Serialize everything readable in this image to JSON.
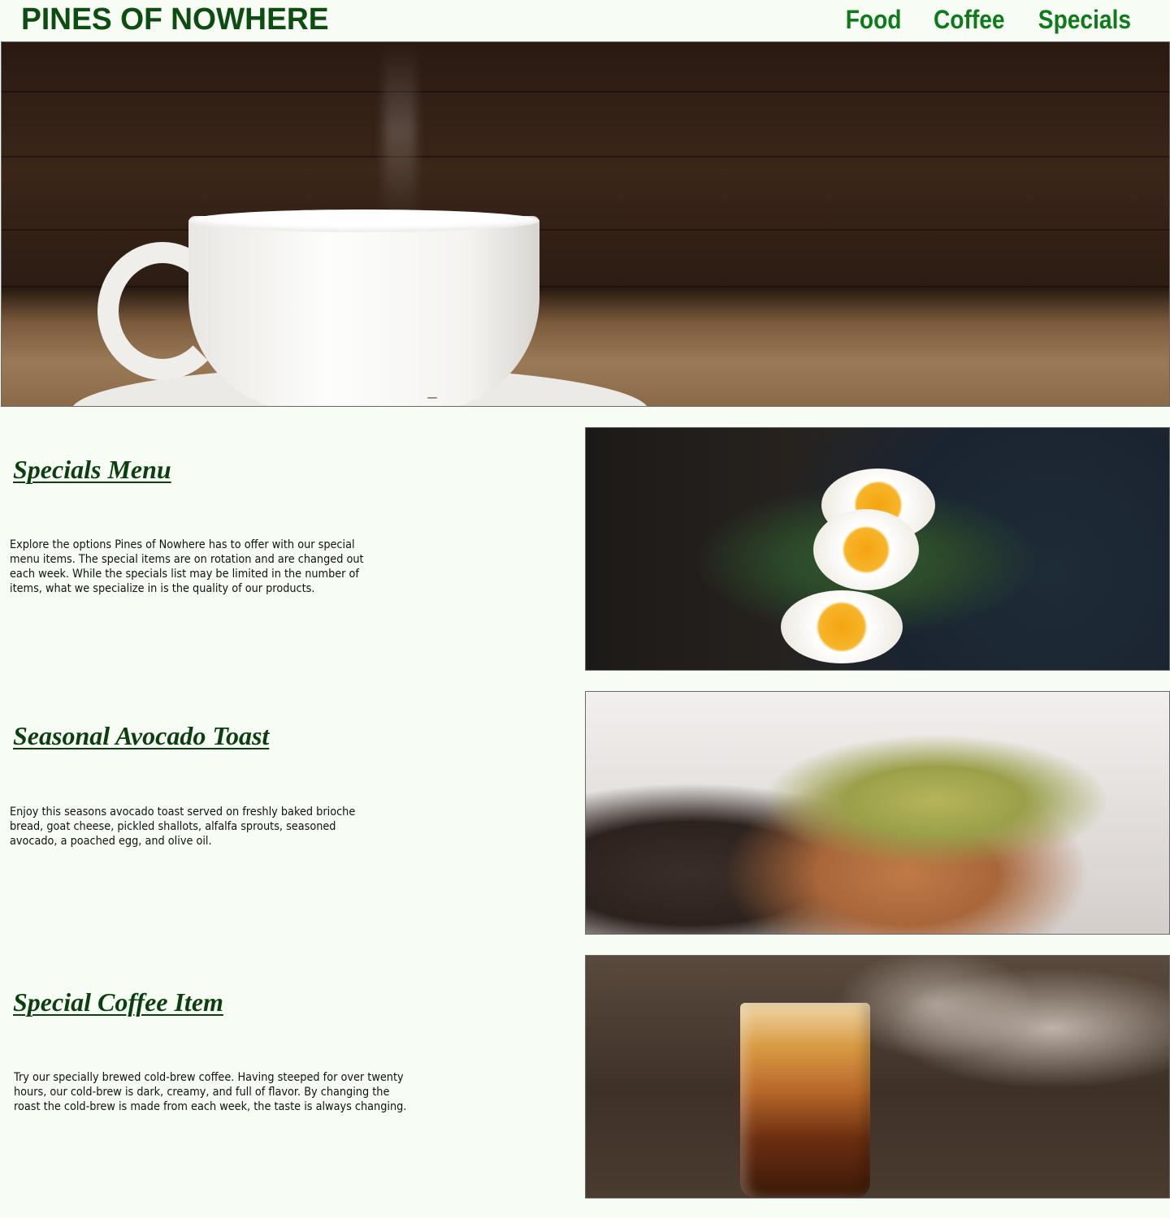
{
  "header": {
    "brand": "PINES OF NOWHERE",
    "nav": [
      "Food",
      "Coffee",
      "Specials"
    ]
  },
  "colors": {
    "background": "#f7fdf4",
    "brand": "#0d4d12",
    "nav": "#0f7a1c",
    "heading": "#0b3f0f"
  },
  "sections": [
    {
      "title": "Specials Menu",
      "body": "Explore the options Pines of Nowhere has to offer with our special menu items. The special items are on rotation and are changed out each week. While the specials list may be limited in the number of items, what we specialize in is the quality of our products.",
      "image": "eggs-avocado-toast-photo"
    },
    {
      "title": "Seasonal Avocado Toast ",
      "body": "Enjoy this seasons avocado toast served on freshly baked brioche bread, goat cheese, pickled shallots, alfalfa sprouts, seasoned avocado, a poached egg, and olive oil.",
      "image": "avocado-toast-poached-egg-photo"
    },
    {
      "title": "Special Coffee Item",
      "body": "Try our specially brewed cold-brew coffee. Having steeped for over twenty hours, our cold-brew is dark, creamy, and full of flavor. By changing the roast the cold-brew is made from each week, the taste is always changing.",
      "image": "iced-cold-brew-photo"
    }
  ],
  "hero_image": "coffee-cup-hero-photo"
}
